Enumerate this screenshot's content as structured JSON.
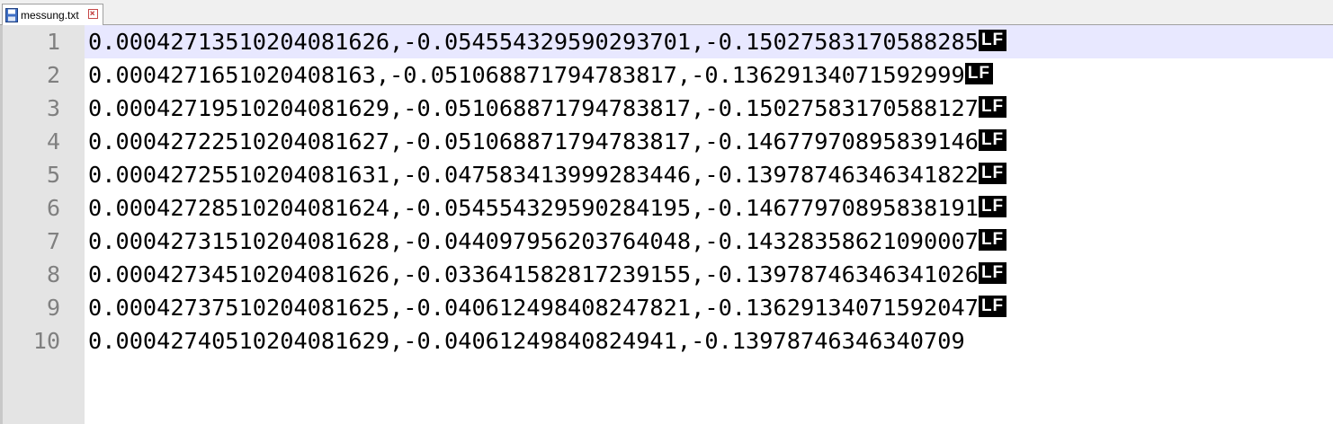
{
  "tab": {
    "filename": "messung.txt",
    "file_icon": "floppy-disk-icon",
    "close_icon": "close-icon"
  },
  "editor": {
    "current_line": 1,
    "eol_marker": "LF",
    "lines": [
      {
        "number": "1",
        "text": "0.0004271351020408​1626,-0.054554329590293701,-0.150275831705882​85",
        "eol": true
      },
      {
        "number": "2",
        "text": "0.00042716510204081​63,-0.051068871794783817,-0.1362913407159299​9",
        "eol": true
      },
      {
        "number": "3",
        "text": "0.0004271951020408​1629,-0.051068871794783817,-0.150275831705881​27",
        "eol": true
      },
      {
        "number": "4",
        "text": "0.0004272251020408​1627,-0.051068871794783817,-0.146779708958391​46",
        "eol": true
      },
      {
        "number": "5",
        "text": "0.0004272551020408​1631,-0.047583413999283446,-0.139787463463418​22",
        "eol": true
      },
      {
        "number": "6",
        "text": "0.0004272851020408​1624,-0.054554329590284195,-0.146779708958381​91",
        "eol": true
      },
      {
        "number": "7",
        "text": "0.0004273151020408​1628,-0.044097956203764048,-0.143283586210900​07",
        "eol": true
      },
      {
        "number": "8",
        "text": "0.0004273451020408​1626,-0.033641582817239155,-0.139787463463410​26",
        "eol": true
      },
      {
        "number": "9",
        "text": "0.0004273751020408​1625,-0.040612498408247821,-0.136291340715920​47",
        "eol": true
      },
      {
        "number": "10",
        "text": "0.0004274051020408​1629,-0.04061249840824941,-0.1397874634634070​9",
        "eol": false
      }
    ]
  }
}
